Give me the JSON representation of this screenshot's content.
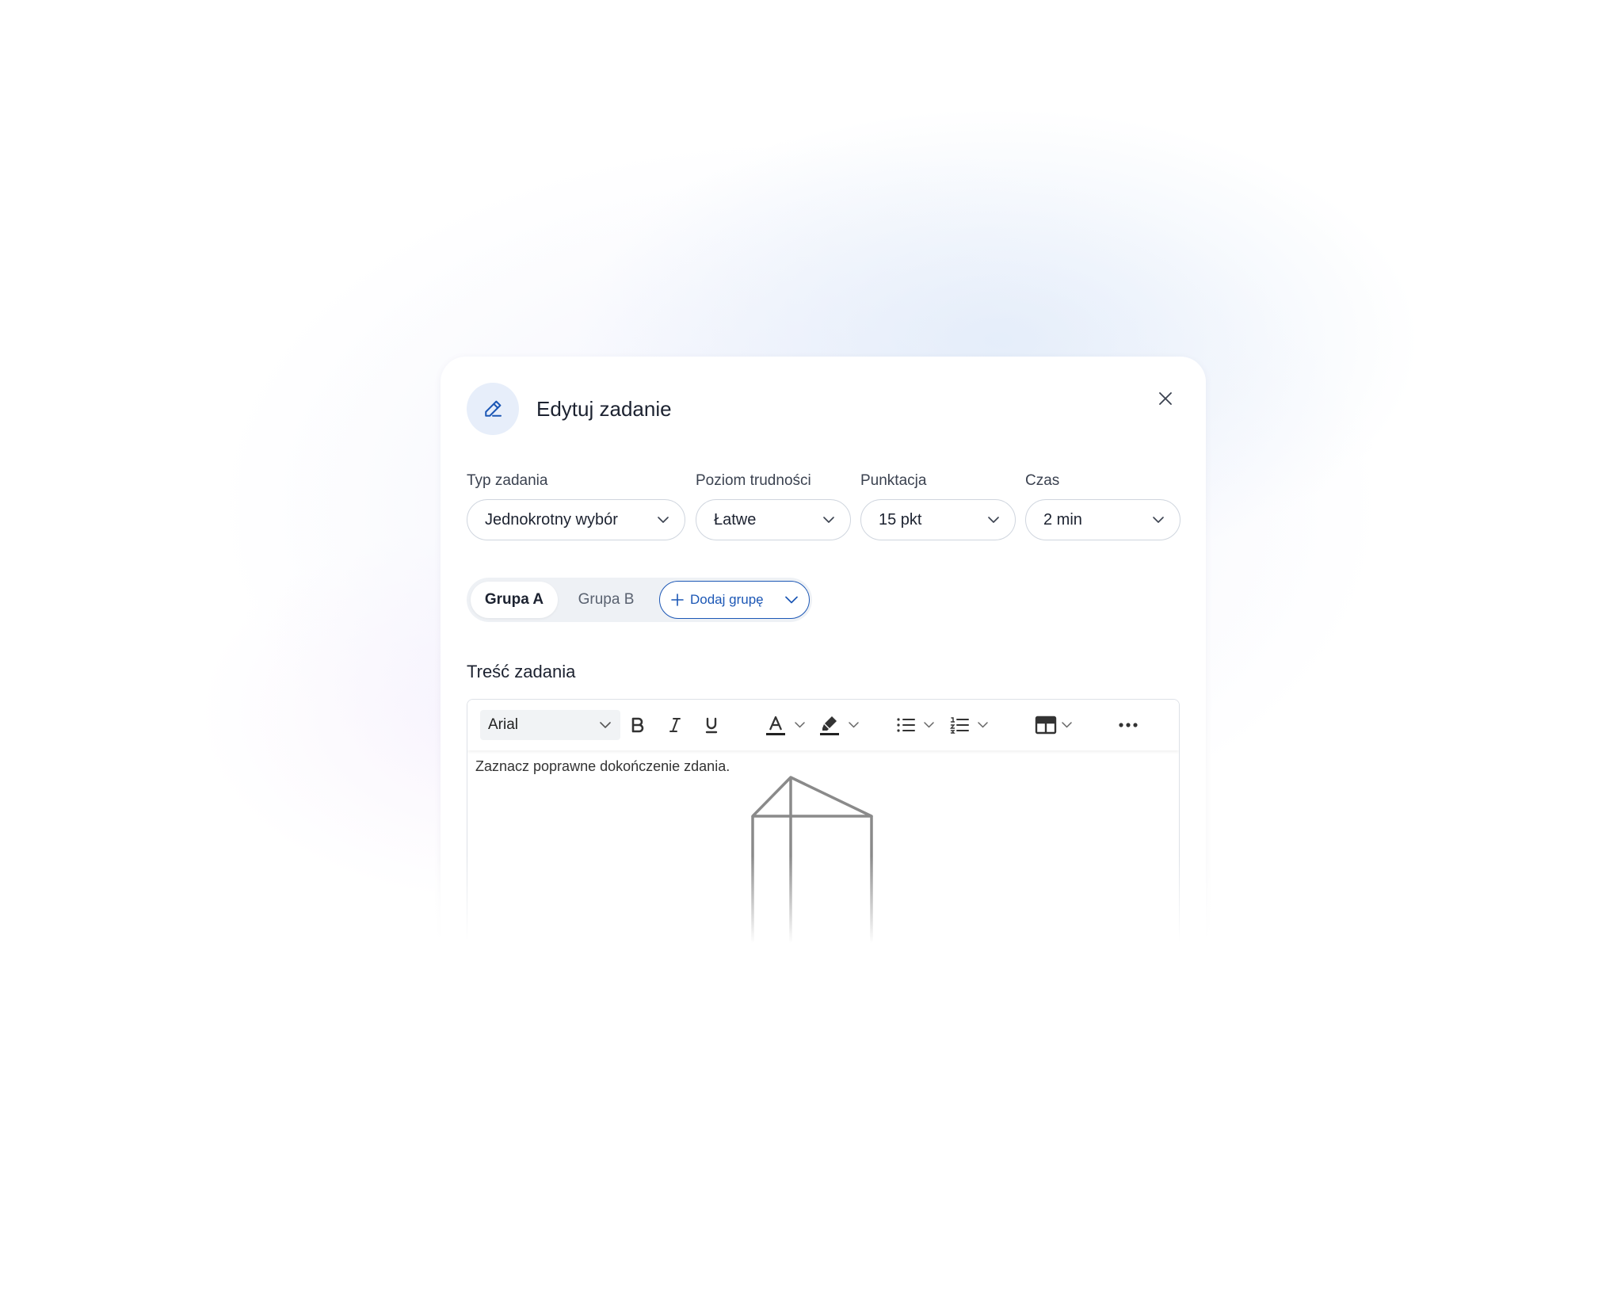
{
  "dialog": {
    "title": "Edytuj zadanie",
    "header_icon": "pencil-icon",
    "close_icon": "close-icon"
  },
  "fields": [
    {
      "label": "Typ zadania",
      "value": "Jednokrotny wybór"
    },
    {
      "label": "Poziom trudności",
      "value": "Łatwe"
    },
    {
      "label": "Punktacja",
      "value": "15 pkt"
    },
    {
      "label": "Czas",
      "value": "2 min"
    }
  ],
  "groups": {
    "tabs": [
      {
        "label": "Grupa A",
        "selected": true
      },
      {
        "label": "Grupa B",
        "selected": false
      }
    ],
    "add_label": "Dodaj grupę"
  },
  "content": {
    "section_title": "Treść zadania",
    "font": "Arial",
    "toolbar_icons": [
      "bold-icon",
      "italic-icon",
      "underline-icon",
      "text-color-icon",
      "highlight-icon",
      "bullet-list-icon",
      "numbered-list-icon",
      "table-icon",
      "more-icon"
    ],
    "body_text": "Zaznacz poprawne dokończenie zdania."
  },
  "colors": {
    "accent": "#1c57b5",
    "icon_bg": "#e7eefa",
    "border": "#cfd5de"
  }
}
